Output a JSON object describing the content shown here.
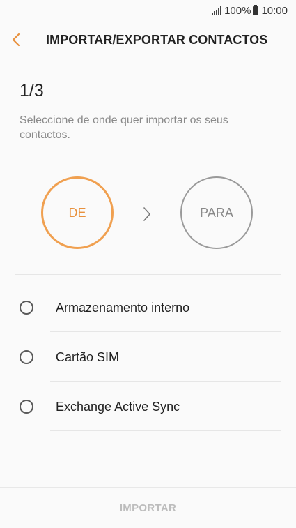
{
  "status_bar": {
    "battery": "100%",
    "time": "10:00",
    "icons": [
      "signal-icon",
      "battery-icon"
    ]
  },
  "header": {
    "title": "IMPORTAR/EXPORTAR CONTACTOS",
    "back_icon": "chevron-left-icon"
  },
  "wizard": {
    "step": "1/3",
    "instructions": "Seleccione de onde quer importar os seus contactos.",
    "from_label": "DE",
    "to_label": "PARA",
    "arrow_icon": "chevron-right-icon"
  },
  "options": [
    {
      "label": "Armazenamento interno"
    },
    {
      "label": "Cartão SIM"
    },
    {
      "label": "Exchange Active Sync"
    }
  ],
  "footer": {
    "import_label": "IMPORTAR"
  },
  "colors": {
    "accent": "#e8913d",
    "disabled_text": "#bdbdbd",
    "muted_text": "#8a8a8a"
  }
}
